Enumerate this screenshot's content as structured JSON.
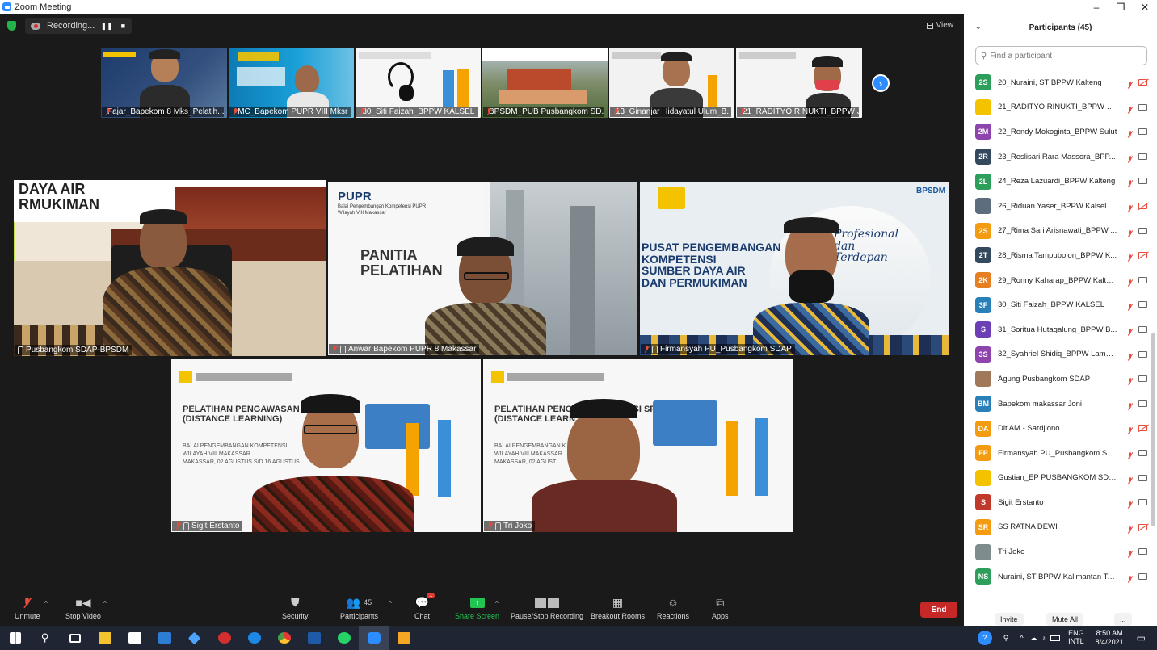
{
  "window": {
    "title": "Zoom Meeting",
    "controls": [
      "–",
      "❐",
      "✕"
    ]
  },
  "recording": {
    "label": "Recording..."
  },
  "view": {
    "label": "View"
  },
  "strip": [
    {
      "name": "Fajar_Bapekom 8 Mks_Pelatih..."
    },
    {
      "name": "MC_Bapekom PUPR VIII Mksr"
    },
    {
      "name": "30_Siti Faizah_BPPW KALSEL"
    },
    {
      "name": "BPSDM_PUB Pusbangkom SD..."
    },
    {
      "name": "13_Ginanjar Hidayatul Ulum_B..."
    },
    {
      "name": "21_RADITYO RINUKTI_BPPW J..."
    }
  ],
  "gallery": [
    {
      "name": "Pusbangkom SDAP-BPSDM",
      "slide": "DAYA AIR\nRMUKIMAN"
    },
    {
      "name": "Anwar Bapekom PUPR 8 Makassar",
      "slide": "PANITIA\nPELATIHAN",
      "logo": "PUPR",
      "subtitle": "Balai Pengembangan Kompetensi PUPR\nWilayah VIII Makassar"
    },
    {
      "name": "Firmansyah PU_Pusbangkom SDAP",
      "slide": "PUSAT PENGEMBANGAN\nKOMPETENSI\nSUMBER DAYA AIR\nDAN PERMUKIMAN",
      "logo": "BPSDM",
      "motto": "Profesional\ndan\nTerdepan"
    },
    {
      "name": "Sigit Erstanto",
      "slide": "PELATIHAN PENGAWASAN ... SPAM\n(DISTANCE LEARNING)",
      "sub": "BALAI PENGEMBANGAN KOMPETENSI\nWILAYAH VIII MAKASSAR\nMAKASSAR, 02 AGUSTUS S/D 16 AGUSTUS"
    },
    {
      "name": "Tri Joko",
      "slide": "PELATIHAN PENGAW... NSTRUKSI SPAM\n(DISTANCE LEARN...",
      "sub": "BALAI PENGEMBANGAN K...\nWILAYAH VIII MAKASSAR\nMAKASSAR, 02 AGUST..."
    }
  ],
  "toolbar": {
    "unmute": "Unmute",
    "stop_video": "Stop Video",
    "security": "Security",
    "participants": "Participants",
    "participants_count": "45",
    "chat": "Chat",
    "chat_badge": "1",
    "share": "Share Screen",
    "pause_rec": "Pause/Stop Recording",
    "breakout": "Breakout Rooms",
    "reactions": "Reactions",
    "apps": "Apps",
    "end": "End"
  },
  "panel": {
    "title": "Participants (45)",
    "search_placeholder": "Find a participant",
    "invite": "Invite",
    "mute_all": "Mute All",
    "more": "...",
    "participants": [
      {
        "initials": "2S",
        "color": "#2e9e5b",
        "name": "20_Nuraini, ST BPPW Kalteng",
        "cam": "off"
      },
      {
        "initials": "",
        "color": "#f4c300",
        "name": "21_RADITYO RINUKTI_BPPW JAT...",
        "cam": "on"
      },
      {
        "initials": "2M",
        "color": "#8e44ad",
        "name": "22_Rendy Mokoginta_BPPW Sulut",
        "cam": "on"
      },
      {
        "initials": "2R",
        "color": "#34495e",
        "name": "23_Reslisari Rara Massora_BPP...",
        "cam": "on"
      },
      {
        "initials": "2L",
        "color": "#2e9e5b",
        "name": "24_Reza Lazuardi_BPPW Kalteng",
        "cam": "on"
      },
      {
        "initials": "",
        "color": "#5d6d7e",
        "name": "26_Riduan Yaser_BPPW Kalsel",
        "cam": "off"
      },
      {
        "initials": "2S",
        "color": "#f39c12",
        "name": "27_Rima Sari Arisnawati_BPPW ...",
        "cam": "on"
      },
      {
        "initials": "2T",
        "color": "#34495e",
        "name": "28_Risma Tampubolon_BPPW K...",
        "cam": "off"
      },
      {
        "initials": "2K",
        "color": "#e67e22",
        "name": "29_Ronny Kaharap_BPPW Kalteng",
        "cam": "on"
      },
      {
        "initials": "3F",
        "color": "#2980b9",
        "name": "30_Siti Faizah_BPPW KALSEL",
        "cam": "on"
      },
      {
        "initials": "S",
        "color": "#6c3fb5",
        "name": "31_Soritua Hutagalung_BPPW B...",
        "cam": "on"
      },
      {
        "initials": "3S",
        "color": "#8e44ad",
        "name": "32_Syahriel Shidiq_BPPW Lampu...",
        "cam": "on"
      },
      {
        "initials": "",
        "color": "#a0785a",
        "name": "Agung Pusbangkom SDAP",
        "cam": "on"
      },
      {
        "initials": "BM",
        "color": "#2980b9",
        "name": "Bapekom makassar Joni",
        "cam": "on"
      },
      {
        "initials": "DA",
        "color": "#f39c12",
        "name": "Dit AM - Sardjiono",
        "cam": "off"
      },
      {
        "initials": "FP",
        "color": "#f39c12",
        "name": "Firmansyah PU_Pusbangkom SD...",
        "cam": "on"
      },
      {
        "initials": "",
        "color": "#f4c300",
        "name": "Gustian_EP PUSBANGKOM SDAP",
        "cam": "on"
      },
      {
        "initials": "S",
        "color": "#c0392b",
        "name": "Sigit Erstanto",
        "cam": "on"
      },
      {
        "initials": "SR",
        "color": "#f39c12",
        "name": "SS RATNA DEWI",
        "cam": "off"
      },
      {
        "initials": "",
        "color": "#7f8c8d",
        "name": "Tri Joko",
        "cam": "on"
      },
      {
        "initials": "NS",
        "color": "#2e9e5b",
        "name": "Nuraini, ST BPPW Kalimantan Tengah",
        "cam": "on"
      }
    ]
  },
  "taskbar": {
    "lang": "ENG\nINTL",
    "time": "8:50 AM",
    "date": "8/4/2021"
  }
}
